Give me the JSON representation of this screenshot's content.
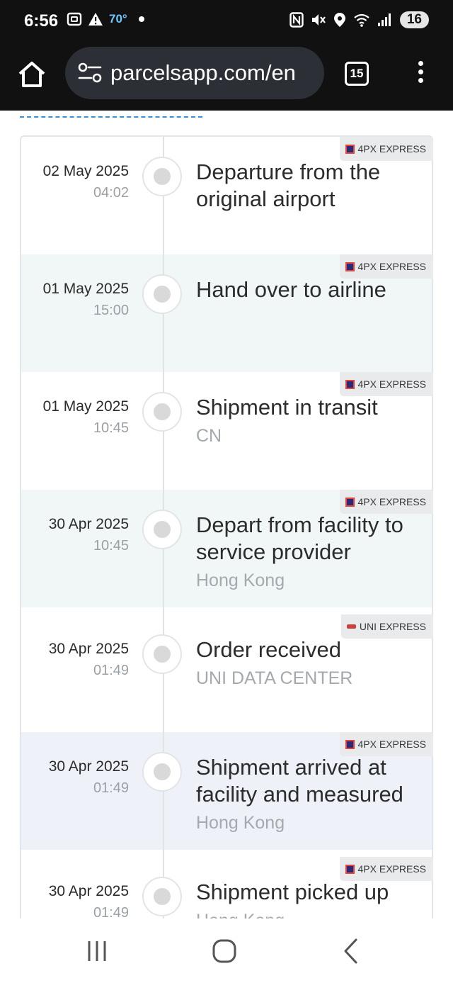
{
  "status_bar": {
    "time": "6:56",
    "temperature": "70°",
    "battery": "16",
    "icons": [
      "screenshot-icon",
      "warning-icon",
      "nfc-icon",
      "mute-icon",
      "location-icon",
      "wifi-icon",
      "signal-icon"
    ]
  },
  "browser": {
    "url": "parcelsapp.com/en",
    "tab_count": "15"
  },
  "events": [
    {
      "date": "02 May 2025",
      "time": "04:02",
      "title": "Departure from the original airport",
      "location": "",
      "carrier": "4PX EXPRESS"
    },
    {
      "date": "01 May 2025",
      "time": "15:00",
      "title": "Hand over to airline",
      "location": "",
      "carrier": "4PX EXPRESS"
    },
    {
      "date": "01 May 2025",
      "time": "10:45",
      "title": "Shipment in transit",
      "location": "CN",
      "carrier": "4PX EXPRESS"
    },
    {
      "date": "30 Apr 2025",
      "time": "10:45",
      "title": "Depart from facility to service provider",
      "location": "Hong Kong",
      "carrier": "4PX EXPRESS"
    },
    {
      "date": "30 Apr 2025",
      "time": "01:49",
      "title": "Order received",
      "location": "UNI DATA CENTER",
      "carrier": "UNI EXPRESS"
    },
    {
      "date": "30 Apr 2025",
      "time": "01:49",
      "title": "Shipment arrived at facility and measured",
      "location": "Hong Kong",
      "carrier": "4PX EXPRESS"
    },
    {
      "date": "30 Apr 2025",
      "time": "01:49",
      "title": "Shipment picked up",
      "location": "Hong Kong",
      "carrier": "4PX EXPRESS"
    }
  ],
  "colors": {
    "status_bg": "#111111",
    "url_pill": "#2c2f36",
    "row_mint": "#f1f7f6",
    "row_blue": "#eef2f8",
    "link": "#3b8fd6"
  }
}
